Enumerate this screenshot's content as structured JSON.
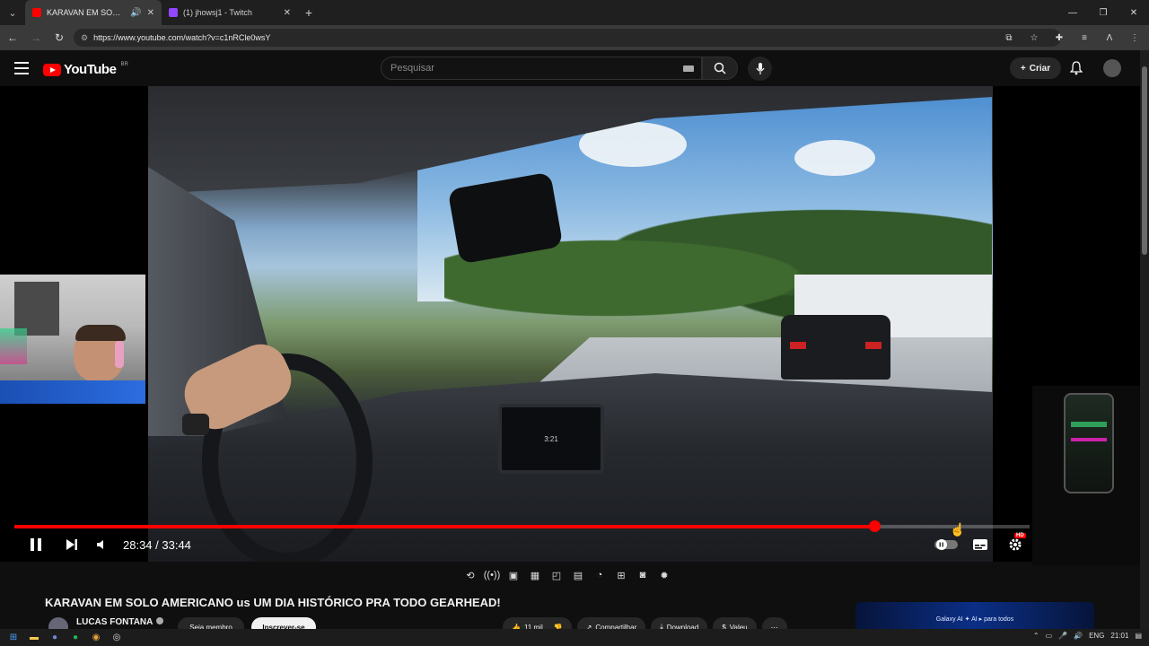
{
  "browser": {
    "tabs": [
      {
        "title": "KARAVAN EM SOLO AMERI",
        "favicon_color": "#ff0000",
        "active": true
      },
      {
        "title": "(1) jhowsj1 - Twitch",
        "favicon_color": "#9146ff",
        "active": false
      }
    ],
    "url": "https://www.youtube.com/watch?v=c1nRCle0wsY"
  },
  "youtube": {
    "logo_text": "YouTube",
    "region": "BR",
    "search_placeholder": "Pesquisar",
    "create_label": "Criar"
  },
  "player": {
    "current_time": "28:34",
    "duration": "33:44",
    "time_display": "28:34 / 33:44",
    "progress": 0.847,
    "dash_screen_text": "3:21",
    "quality_badge": "HD"
  },
  "video_info": {
    "title": "KARAVAN EM SOLO AMERICANO us UM DIA HISTÓRICO PRA TODO GEARHEAD!",
    "channel": "LUCAS FONTANA",
    "member_label": "Seja membro",
    "subscribe_label": "Inscrever-se",
    "likes": "11 mil",
    "share_label": "Compartilhar",
    "download_label": "Download",
    "thanks_label": "Valeu"
  },
  "ad": {
    "text": "Galaxy AI ✦ AI ▸ para todos"
  },
  "taskbar": {
    "language": "ENG",
    "clock": "21:01"
  },
  "colors": {
    "progress": "#ff0000",
    "youtube_red": "#ff0000",
    "background": "#0f0f0f"
  }
}
